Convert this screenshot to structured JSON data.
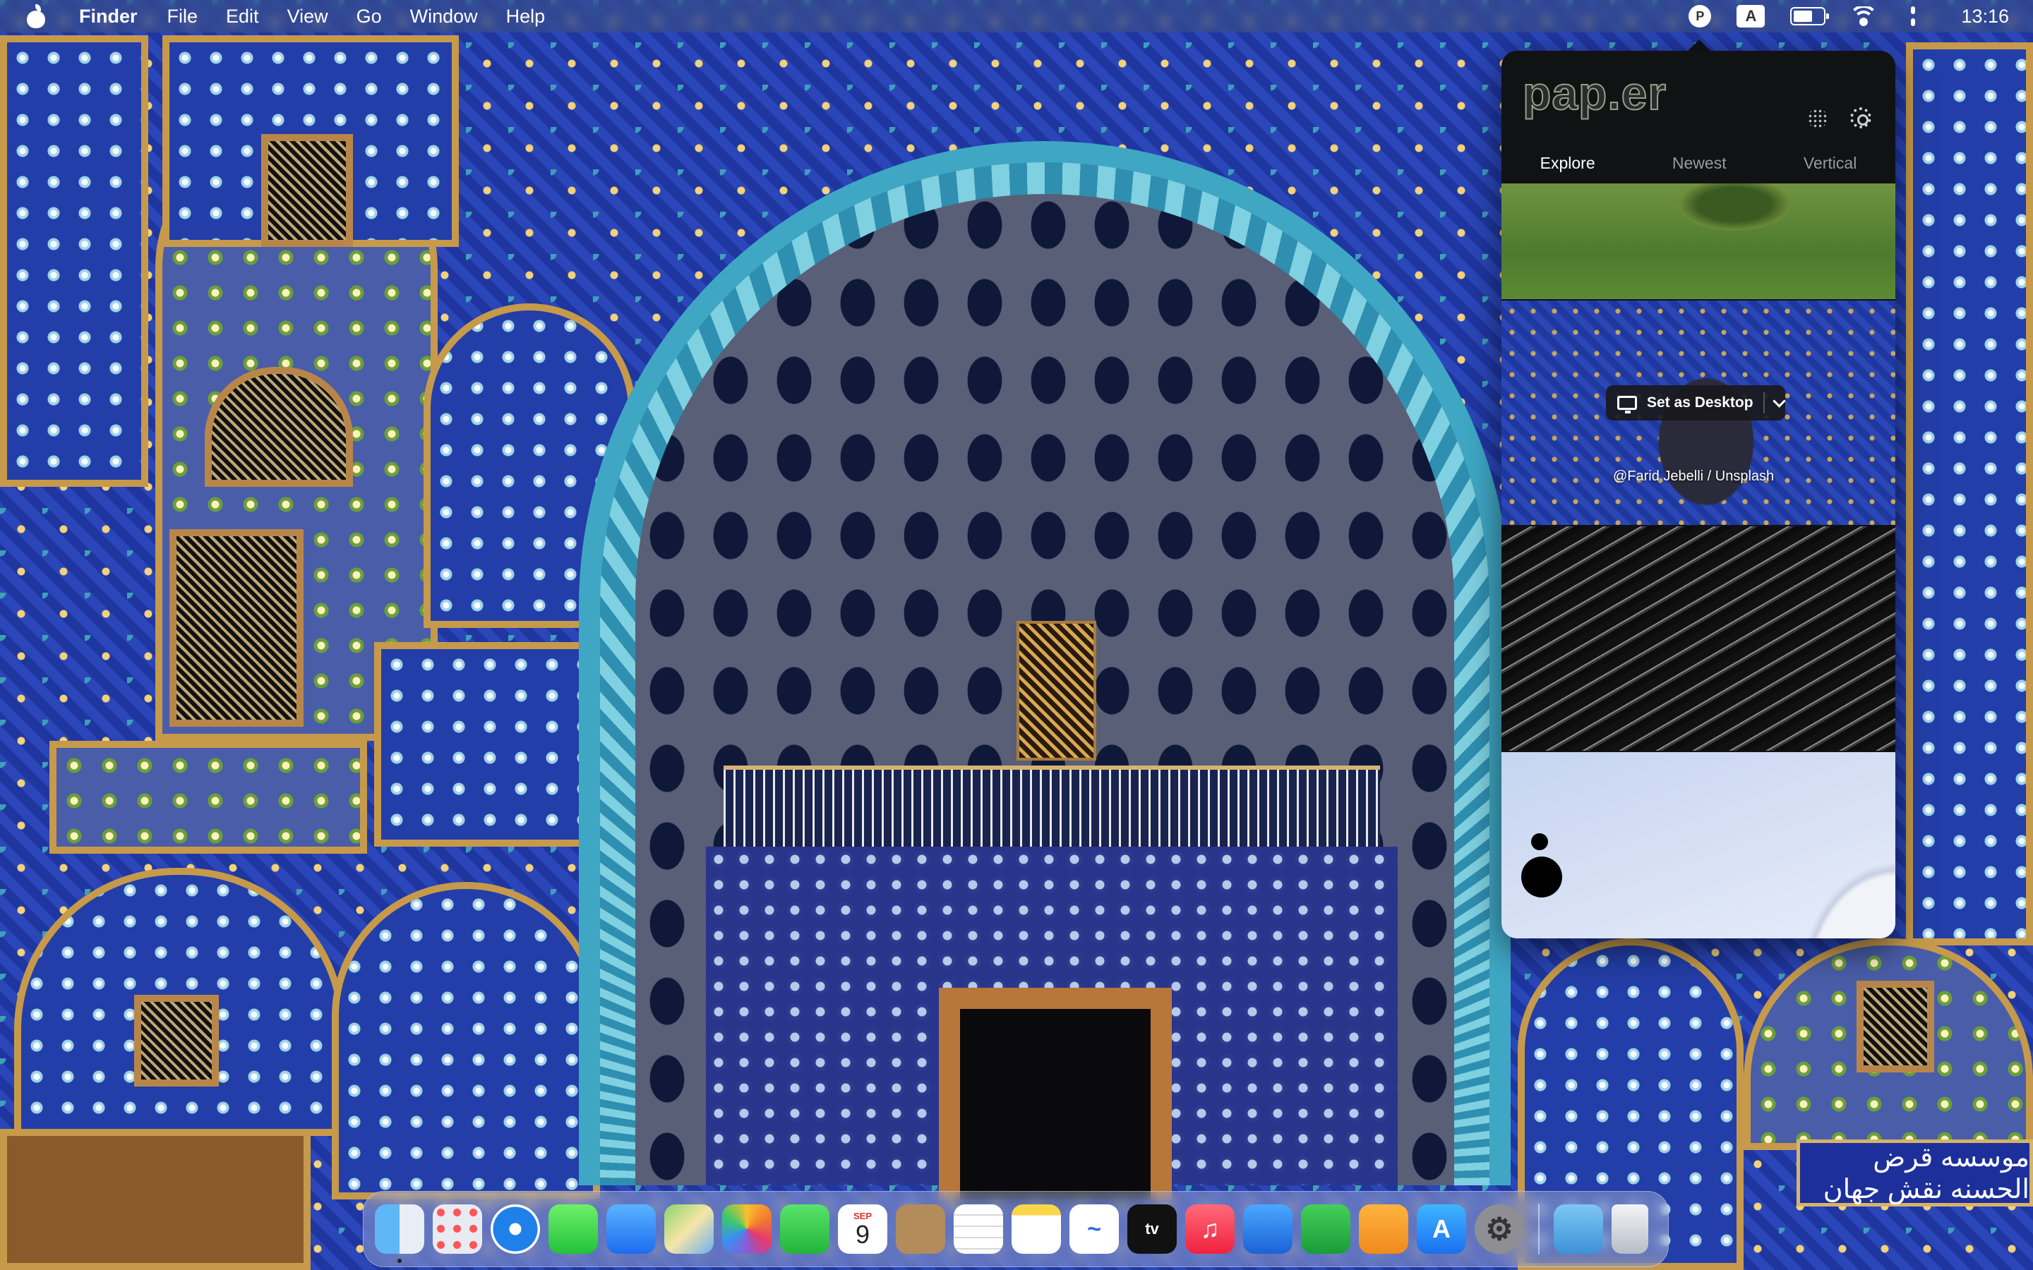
{
  "menubar": {
    "app_name": "Finder",
    "menus": [
      "File",
      "Edit",
      "View",
      "Go",
      "Window",
      "Help"
    ],
    "status": {
      "paper_icon_letter": "P",
      "input_source": "A",
      "clock": "13:16"
    }
  },
  "paper_app": {
    "logo": "pap.er",
    "tabs": [
      "Explore",
      "Newest",
      "Vertical"
    ],
    "active_tab": "Explore",
    "set_desktop_label": "Set as Desktop",
    "credit": "@Farid Jebelli / Unsplash"
  },
  "dock": {
    "apps": [
      {
        "name": "finder",
        "glyph": ""
      },
      {
        "name": "launchpad",
        "glyph": ""
      },
      {
        "name": "safari",
        "glyph": ""
      },
      {
        "name": "messages",
        "glyph": ""
      },
      {
        "name": "mail",
        "glyph": ""
      },
      {
        "name": "maps",
        "glyph": ""
      },
      {
        "name": "photos",
        "glyph": ""
      },
      {
        "name": "facetime",
        "glyph": ""
      },
      {
        "name": "calendar",
        "glyph": ""
      },
      {
        "name": "contacts",
        "glyph": ""
      },
      {
        "name": "reminders",
        "glyph": ""
      },
      {
        "name": "notes",
        "glyph": ""
      },
      {
        "name": "freeform",
        "glyph": ""
      },
      {
        "name": "apple-tv",
        "glyph": "tv"
      },
      {
        "name": "music",
        "glyph": "♫"
      },
      {
        "name": "keynote",
        "glyph": ""
      },
      {
        "name": "numbers",
        "glyph": ""
      },
      {
        "name": "pages",
        "glyph": ""
      },
      {
        "name": "app-store",
        "glyph": "A"
      },
      {
        "name": "system-settings",
        "glyph": "⚙"
      }
    ],
    "calendar": {
      "month": "SEP",
      "day": "9"
    },
    "trailing": [
      {
        "name": "downloads"
      },
      {
        "name": "trash"
      }
    ]
  },
  "wallpaper": {
    "sign_text": "موسسه قرض الحسنه نقش جهان"
  },
  "colors": {
    "tile_blue": "#233ea8",
    "tile_gold": "#c69a4a",
    "turquoise": "#3fa7c4",
    "popover_bg": "#111214"
  }
}
